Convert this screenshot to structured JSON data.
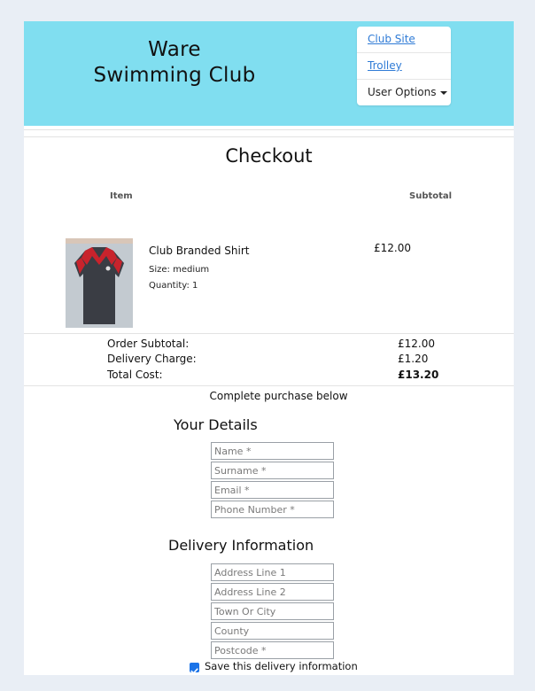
{
  "header": {
    "brand_line1": "Ware",
    "brand_line2": "Swimming Club",
    "nav": {
      "club_site": "Club Site",
      "trolley": "Trolley",
      "user_options": "User Options"
    }
  },
  "checkout": {
    "title": "Checkout",
    "columns": {
      "item": "Item",
      "subtotal": "Subtotal"
    },
    "items": [
      {
        "name": "Club Branded Shirt",
        "size": "Size: medium",
        "quantity": "Quantity: 1",
        "price": "£12.00",
        "image": "shirt-image"
      }
    ],
    "summary": {
      "order_subtotal_label": "Order Subtotal:",
      "order_subtotal": "£12.00",
      "delivery_label": "Delivery Charge:",
      "delivery": "£1.20",
      "total_label": "Total Cost:",
      "total": "£13.20"
    },
    "complete_text": "Complete purchase below"
  },
  "details": {
    "heading": "Your Details",
    "name_placeholder": "Name *",
    "surname_placeholder": "Surname *",
    "email_placeholder": "Email *",
    "phone_placeholder": "Phone Number *"
  },
  "delivery": {
    "heading": "Delivery Information",
    "address1_placeholder": "Address Line 1",
    "address2_placeholder": "Address Line 2",
    "town_placeholder": "Town Or City",
    "county_placeholder": "County",
    "postcode_placeholder": "Postcode *",
    "save_label": "Save this delivery information",
    "save_checked": true
  },
  "colors": {
    "header_bg": "#80def0",
    "link": "#2f7bd6",
    "checkbox": "#1a73e8",
    "page_bg": "#e9eef5"
  }
}
